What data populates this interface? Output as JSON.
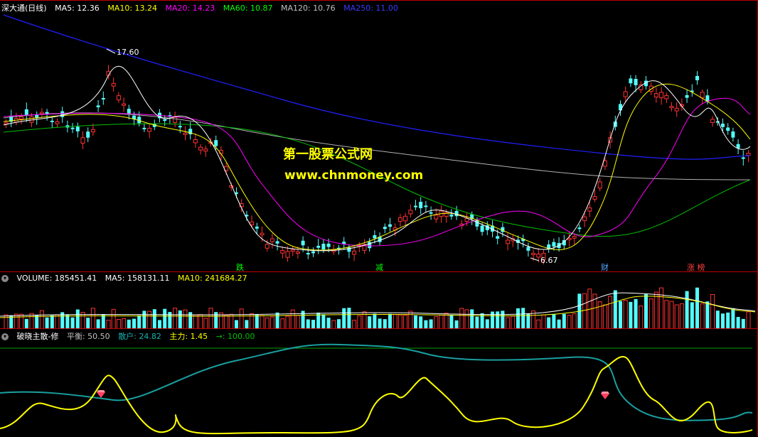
{
  "main_header": {
    "title": "深大通(日线)",
    "ma5": "MA5: 12.36",
    "ma10": "MA10: 13.24",
    "ma20": "MA20: 14.23",
    "ma60": "MA60: 10.87",
    "ma120": "MA120: 10.76",
    "ma250": "MA250: 11.00"
  },
  "price_annotations": {
    "high": "17.60",
    "low": "6.67"
  },
  "watermark": {
    "line1": "第一股票公式网",
    "line2": "www.chnmoney.com"
  },
  "event_markers": [
    "跌",
    "减",
    "财",
    "涨 榜"
  ],
  "volume_header": {
    "label": "VOLUME: 185451.41",
    "ma5": "MA5: 158131.11",
    "ma10": "MA10: 241684.27"
  },
  "indicator_header": {
    "name": "破晓主散-修",
    "pingheng": "平衡: 50.50",
    "sanhu": "散户: 24.82",
    "zhuli": "主力: 1.45",
    "arrow": "→: 100.00"
  },
  "colors": {
    "up": "#ff3232",
    "down": "#54ffff",
    "ma5": "#ffffff",
    "ma10": "#ffff00",
    "ma20": "#ff00ff",
    "ma60": "#00ff00",
    "ma120": "#c0c0c0",
    "ma250": "#2020ff",
    "indicator_zhuli": "#ffff00",
    "indicator_sanhu": "#1a9fa0",
    "indicator_line": "#00a000"
  }
}
